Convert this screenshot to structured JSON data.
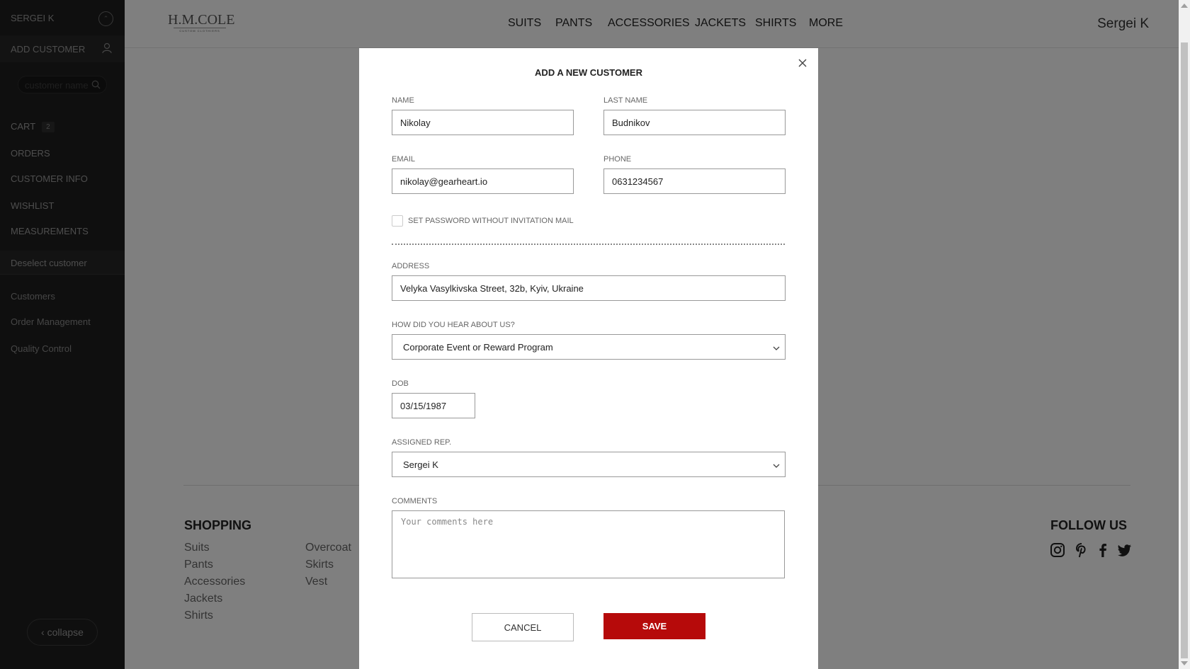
{
  "sidebar": {
    "user_name": "SERGEI K",
    "add_customer": "ADD CUSTOMER",
    "search_placeholder": "customer name",
    "cart_label": "CART",
    "cart_count": "2",
    "orders": "ORDERS",
    "customer_info": "CUSTOMER INFO",
    "wishlist": "WISHLIST",
    "measurements": "MEASUREMENTS",
    "deselect": "Deselect customer",
    "links": [
      "Customers",
      "Order Management",
      "Quality Control"
    ],
    "collapse": "collapse"
  },
  "header": {
    "logo": "H.M.COLE",
    "logo_sub": "CUSTOM CLOTHIERS",
    "nav": [
      "SUITS",
      "PANTS",
      "ACCESSORIES",
      "JACKETS",
      "SHIRTS",
      "MORE"
    ],
    "user": "Sergei K"
  },
  "footer": {
    "shopping_title": "SHOPPING",
    "shopping_col1": [
      "Suits",
      "Pants",
      "Accessories",
      "Jackets",
      "Shirts"
    ],
    "shopping_col2": [
      "Overcoat",
      "Skirts",
      "Vest"
    ],
    "follow_title": "FOLLOW US",
    "social_icons": [
      "instagram-icon",
      "pinterest-icon",
      "facebook-icon",
      "twitter-icon"
    ]
  },
  "modal": {
    "title": "ADD A NEW CUSTOMER",
    "name_label": "NAME",
    "name_value": "Nikolay",
    "last_name_label": "LAST NAME",
    "last_name_value": "Budnikov",
    "email_label": "EMAIL",
    "email_value": "nikolay@gearheart.io",
    "phone_label": "PHONE",
    "phone_value": "0631234567",
    "set_password_label": "SET PASSWORD WITHOUT INVITATION MAIL",
    "set_password_checked": false,
    "address_label": "ADDRESS",
    "address_value": "Velyka Vasylkivska Street, 32b, Kyiv, Ukraine",
    "hear_label": "HOW DID YOU HEAR ABOUT US?",
    "hear_value": "Corporate Event or Reward Program",
    "dob_label": "DOB",
    "dob_value": "03/15/1987",
    "rep_label": "ASSIGNED REP.",
    "rep_value": "Sergei K",
    "comments_label": "COMMENTS",
    "comments_placeholder": "Your comments here",
    "cancel": "CANCEL",
    "save": "SAVE"
  },
  "colors": {
    "sidebar_bg": "#1f1f1f",
    "save_button": "#b60a0a",
    "overlay": "rgba(0,0,0,0.5)"
  }
}
